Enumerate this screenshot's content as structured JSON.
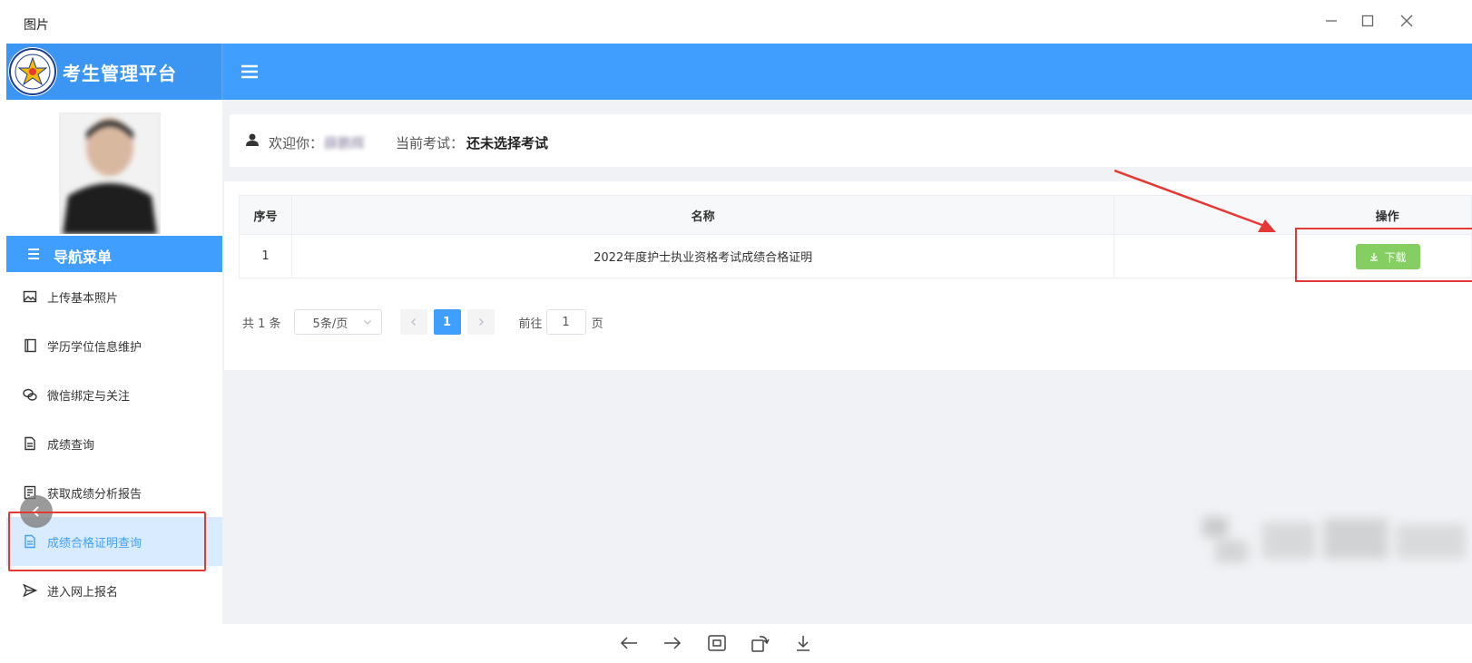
{
  "viewer": {
    "title": "图片"
  },
  "app": {
    "title": "考生管理平台"
  },
  "sidebar": {
    "nav_header": "导航菜单",
    "items": [
      {
        "label": "上传基本照片",
        "icon": "image-icon"
      },
      {
        "label": "学历学位信息维护",
        "icon": "book-icon"
      },
      {
        "label": "微信绑定与关注",
        "icon": "wechat-icon"
      },
      {
        "label": "成绩查询",
        "icon": "document-icon"
      },
      {
        "label": "获取成绩分析报告",
        "icon": "report-icon"
      },
      {
        "label": "成绩合格证明查询",
        "icon": "document-icon",
        "active": true
      },
      {
        "label": "进入网上报名",
        "icon": "send-icon"
      }
    ]
  },
  "welcome": {
    "label": "欢迎你：",
    "name": "薛鹏辉",
    "exam_label": "当前考试：",
    "exam_value": "还未选择考试"
  },
  "table": {
    "headers": [
      "序号",
      "名称",
      "操作"
    ],
    "rows": [
      {
        "index": "1",
        "name": "2022年度护士执业资格考试成绩合格证明",
        "action": "下载"
      }
    ]
  },
  "pagination": {
    "total": "共 1 条",
    "page_size": "5条/页",
    "current_page": "1",
    "goto_label": "前往",
    "goto_value": "1",
    "page_suffix": "页"
  },
  "colors": {
    "primary": "#409eff",
    "success": "#85ce61",
    "highlight": "#e53935"
  }
}
